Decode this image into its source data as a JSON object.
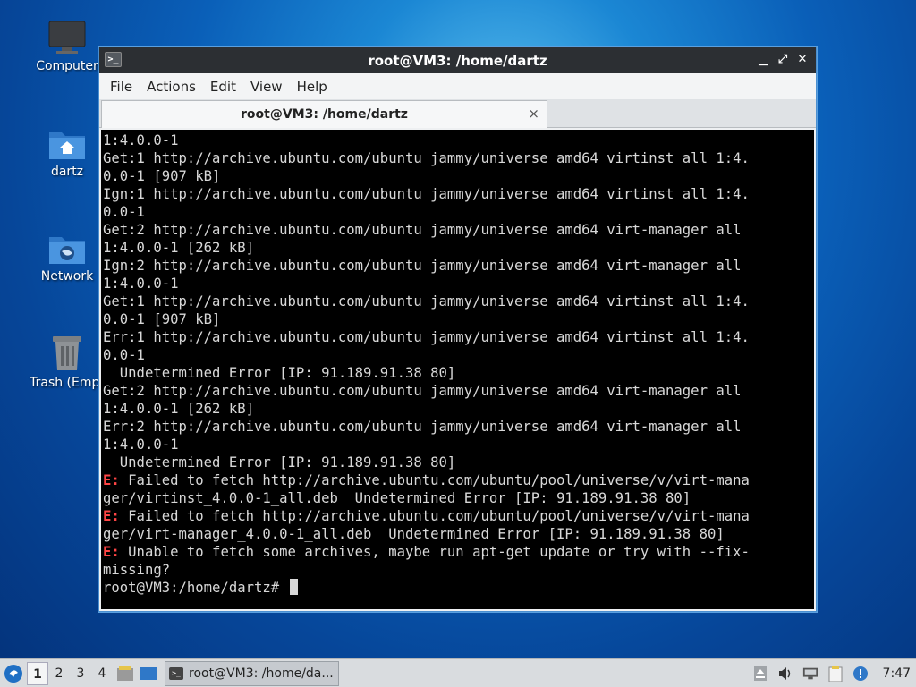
{
  "desktop": {
    "icons": [
      {
        "label": "Computer"
      },
      {
        "label": "dartz"
      },
      {
        "label": "Network"
      },
      {
        "label": "Trash (Empt"
      }
    ]
  },
  "window": {
    "title": "root@VM3: /home/dartz",
    "menu": [
      "File",
      "Actions",
      "Edit",
      "View",
      "Help"
    ],
    "tab_label": "root@VM3: /home/dartz",
    "tab_close": "×"
  },
  "terminal": {
    "lines": [
      {
        "prefix": "",
        "text": "1:4.0.0-1"
      },
      {
        "prefix": "",
        "text": "Get:1 http://archive.ubuntu.com/ubuntu jammy/universe amd64 virtinst all 1:4."
      },
      {
        "prefix": "",
        "text": "0.0-1 [907 kB]"
      },
      {
        "prefix": "",
        "text": "Ign:1 http://archive.ubuntu.com/ubuntu jammy/universe amd64 virtinst all 1:4."
      },
      {
        "prefix": "",
        "text": "0.0-1"
      },
      {
        "prefix": "",
        "text": "Get:2 http://archive.ubuntu.com/ubuntu jammy/universe amd64 virt-manager all"
      },
      {
        "prefix": "",
        "text": "1:4.0.0-1 [262 kB]"
      },
      {
        "prefix": "",
        "text": "Ign:2 http://archive.ubuntu.com/ubuntu jammy/universe amd64 virt-manager all"
      },
      {
        "prefix": "",
        "text": "1:4.0.0-1"
      },
      {
        "prefix": "",
        "text": "Get:1 http://archive.ubuntu.com/ubuntu jammy/universe amd64 virtinst all 1:4."
      },
      {
        "prefix": "",
        "text": "0.0-1 [907 kB]"
      },
      {
        "prefix": "",
        "text": "Err:1 http://archive.ubuntu.com/ubuntu jammy/universe amd64 virtinst all 1:4."
      },
      {
        "prefix": "",
        "text": "0.0-1"
      },
      {
        "prefix": "",
        "text": "  Undetermined Error [IP: 91.189.91.38 80]"
      },
      {
        "prefix": "",
        "text": "Get:2 http://archive.ubuntu.com/ubuntu jammy/universe amd64 virt-manager all"
      },
      {
        "prefix": "",
        "text": "1:4.0.0-1 [262 kB]"
      },
      {
        "prefix": "",
        "text": "Err:2 http://archive.ubuntu.com/ubuntu jammy/universe amd64 virt-manager all"
      },
      {
        "prefix": "",
        "text": "1:4.0.0-1"
      },
      {
        "prefix": "",
        "text": "  Undetermined Error [IP: 91.189.91.38 80]"
      },
      {
        "prefix": "E:",
        "text": " Failed to fetch http://archive.ubuntu.com/ubuntu/pool/universe/v/virt-mana"
      },
      {
        "prefix": "",
        "text": "ger/virtinst_4.0.0-1_all.deb  Undetermined Error [IP: 91.189.91.38 80]"
      },
      {
        "prefix": "E:",
        "text": " Failed to fetch http://archive.ubuntu.com/ubuntu/pool/universe/v/virt-mana"
      },
      {
        "prefix": "",
        "text": "ger/virt-manager_4.0.0-1_all.deb  Undetermined Error [IP: 91.189.91.38 80]"
      },
      {
        "prefix": "E:",
        "text": " Unable to fetch some archives, maybe run apt-get update or try with --fix-"
      },
      {
        "prefix": "",
        "text": "missing?"
      }
    ],
    "prompt": "root@VM3:/home/dartz# ",
    "error_color": "#ff4545"
  },
  "taskbar": {
    "workspaces": [
      "1",
      "2",
      "3",
      "4"
    ],
    "active_workspace": "1",
    "task_label": "root@VM3: /home/da...",
    "clock": "7:47"
  }
}
